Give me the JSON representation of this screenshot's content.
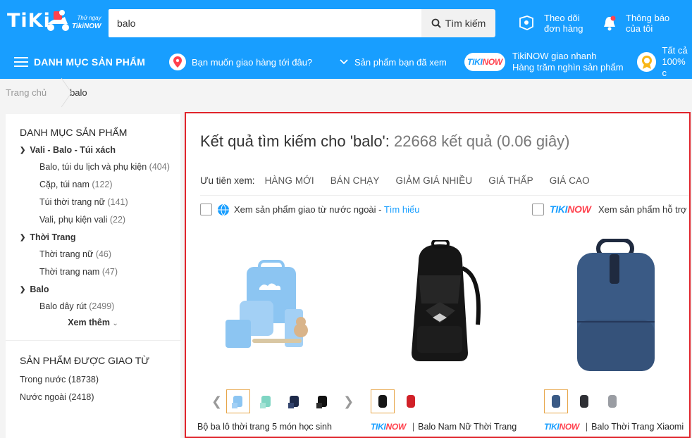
{
  "header": {
    "logo": "TiKi",
    "tikinow_tagline": "Thử ngay",
    "tikinow_label": "TikiNOW",
    "search": {
      "value": "balo",
      "button_label": "Tìm kiếm"
    },
    "track_order": {
      "line1": "Theo dõi",
      "line2": "đơn hàng"
    },
    "notifications": {
      "line1": "Thông báo",
      "line2": "của tôi"
    }
  },
  "nav": {
    "categories_label": "DANH MỤC SẢN PHẨM",
    "delivery_location": "Bạn muốn giao hàng tới đâu?",
    "viewed_products": "Sản phẩm bạn đã xem",
    "tikinow_badge_ti": "TIKI",
    "tikinow_badge_now": "NOW",
    "tikinow_line1": "TikiNOW giao nhanh",
    "tikinow_line2": "Hàng trăm nghìn sản phẩm",
    "all_line1": "Tất cả",
    "all_line2": "100% c"
  },
  "breadcrumb": {
    "home": "Trang chủ",
    "current": "balo"
  },
  "sidebar": {
    "categories_title": "DANH MỤC SẢN PHẨM",
    "groups": [
      {
        "label": "Vali - Balo - Túi xách",
        "children": [
          {
            "label": "Balo, túi du lịch và phụ kiện",
            "count": "(404)"
          },
          {
            "label": "Cặp, túi nam",
            "count": "(122)"
          },
          {
            "label": "Túi thời trang nữ",
            "count": "(141)"
          },
          {
            "label": "Vali, phụ kiện vali",
            "count": "(22)"
          }
        ]
      },
      {
        "label": "Thời Trang",
        "children": [
          {
            "label": "Thời trang nữ",
            "count": "(46)"
          },
          {
            "label": "Thời trang nam",
            "count": "(47)"
          }
        ]
      },
      {
        "label": "Balo",
        "children": [
          {
            "label": "Balo dây rút",
            "count": "(2499)"
          }
        ]
      }
    ],
    "show_more": "Xem thêm",
    "origin_title": "SẢN PHẨM ĐƯỢC GIAO TỪ",
    "origin": [
      {
        "label": "Trong nước",
        "count": "(18738)"
      },
      {
        "label": "Nước ngoài",
        "count": "(2418)"
      }
    ]
  },
  "results": {
    "title_prefix": "Kết quả tìm kiếm cho 'balo':",
    "title_count": "22668 kết quả (0.06 giây)",
    "sort_label": "Ưu tiên xem:",
    "sort_options": [
      "HÀNG MỚI",
      "BÁN CHẠY",
      "GIẢM GIÁ NHIỀU",
      "GIÁ THẤP",
      "GIÁ CAO"
    ],
    "filter_foreign": "Xem sản phẩm giao từ nước ngoài - ",
    "filter_foreign_link": "Tìm hiểu",
    "filter_tikinow": "Xem sản phẩm hỗ trợ T",
    "products": [
      {
        "name": "Bộ ba lô thời trang 5 món học sinh",
        "tikinow": false
      },
      {
        "name": "Balo Nam Nữ Thời Trang",
        "tikinow": true
      },
      {
        "name": "Balo Thời Trang Xiaomi",
        "tikinow": true
      }
    ]
  },
  "colors": {
    "brand": "#189eff",
    "now_red": "#ff424e",
    "highlight_border": "#e0242b"
  }
}
